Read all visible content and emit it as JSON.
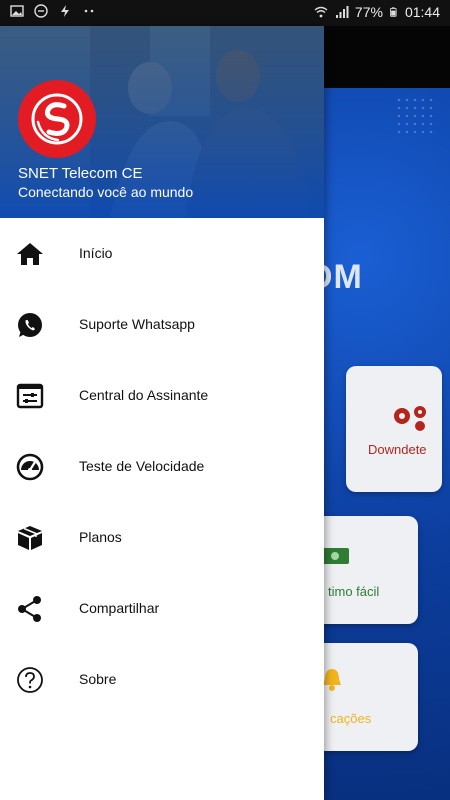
{
  "status_bar": {
    "battery": "77%",
    "time": "01:44",
    "left_icons": [
      "image-icon",
      "minus-circle-icon",
      "flash-icon",
      "more-icon"
    ],
    "right_icons": [
      "wifi-icon",
      "signal-icon",
      "battery-icon"
    ]
  },
  "drawer": {
    "header": {
      "title": "SNET Telecom CE",
      "subtitle": "Conectando você ao mundo",
      "logo_color": "#e31b23"
    },
    "items": [
      {
        "label": "Início",
        "icon": "home-icon"
      },
      {
        "label": "Suporte Whatsapp",
        "icon": "whatsapp-icon"
      },
      {
        "label": "Central do Assinante",
        "icon": "settings-panel-icon"
      },
      {
        "label": "Teste de Velocidade",
        "icon": "speedometer-icon"
      },
      {
        "label": "Planos",
        "icon": "box-icon"
      },
      {
        "label": "Compartilhar",
        "icon": "share-icon"
      },
      {
        "label": "Sobre",
        "icon": "help-icon"
      }
    ]
  },
  "background": {
    "brand_fragment": "OM",
    "cards": [
      {
        "label": "Downdete",
        "icon": "gears-icon",
        "color": "#b3261e"
      },
      {
        "label": "timo fácil",
        "icon": "money-icon",
        "color": "#2e7d32"
      },
      {
        "label": "cações",
        "icon": "bell-icon",
        "color": "#f2b51d"
      }
    ]
  }
}
